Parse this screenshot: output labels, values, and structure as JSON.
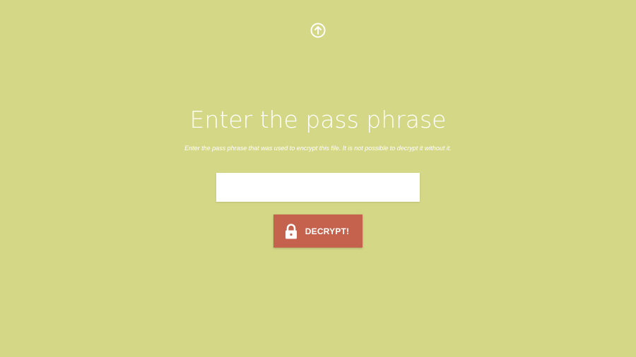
{
  "page": {
    "background_color": "#d4d786",
    "accent_color": "#c4624e"
  },
  "nav": {
    "back_icon": "arrow-up-circle-icon"
  },
  "header": {
    "title": "Enter the pass phrase",
    "subtitle": "Enter the pass phrase that was used to encrypt this file. It is not possible to decrypt it without it."
  },
  "form": {
    "passphrase_value": "",
    "passphrase_placeholder": "",
    "submit_icon": "lock-icon",
    "submit_label": "DECRYPT!"
  }
}
